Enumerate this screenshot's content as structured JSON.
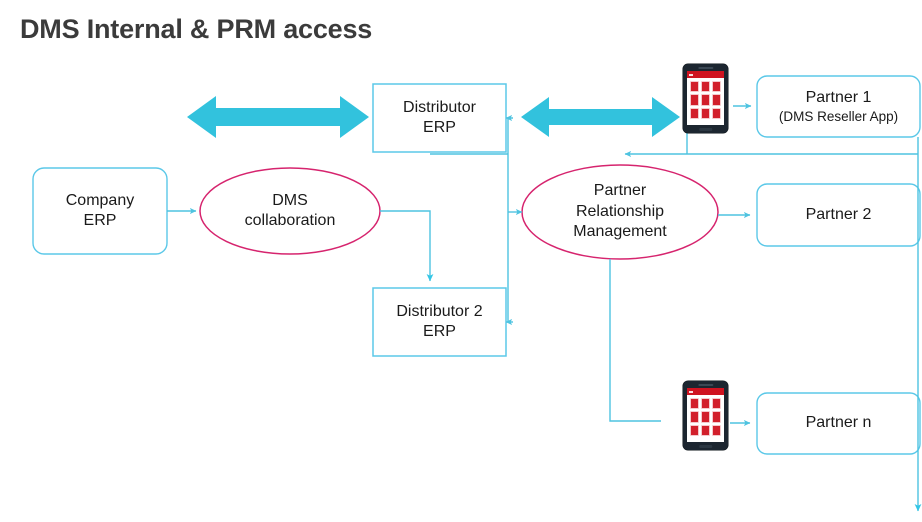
{
  "title": "DMS Internal & PRM access",
  "colors": {
    "connector": "#4ec3e0",
    "big_arrow": "#32c2dd",
    "box_border": "#5bc8e8",
    "ellipse_border": "#d6246e",
    "text": "#1a1a1a",
    "title": "#3b3b3b",
    "phone_body": "#1c2630",
    "phone_accent": "#cf1320",
    "background": "#ffffff"
  },
  "nodes": {
    "company_erp": {
      "line1": "Company",
      "line2": "ERP"
    },
    "dms_collaboration": {
      "line1": "DMS",
      "line2": "collaboration"
    },
    "distributor_erp": {
      "line1": "Distributor",
      "line2": "ERP"
    },
    "distributor2_erp": {
      "line1": "Distributor 2",
      "line2": "ERP"
    },
    "prm": {
      "line1": "Partner",
      "line2": "Relationship",
      "line3": "Management"
    },
    "partner1": {
      "line1": "Partner 1",
      "line2": "(DMS Reseller App)"
    },
    "partner2": {
      "line1": "Partner 2"
    },
    "partner_n": {
      "line1": "Partner n"
    }
  },
  "icons": {
    "phone_top": "smartphone-reseller-app-icon",
    "phone_bottom": "smartphone-reseller-app-icon"
  },
  "connectors": {
    "company_to_dms": "arrow-right",
    "dms_to_distributor2": "arrow-down",
    "bus_to_distributor_erp": "arrow-left",
    "bus_to_prm": "arrow-right",
    "bus_to_distributor2_erp": "arrow-left",
    "partner_return_to_prm": "arrow-left",
    "prm_to_partner2": "arrow-right",
    "phone_to_partner1": "arrow-right",
    "phone_to_partner_n": "arrow-right",
    "partner_bus_down": "arrow-down",
    "distributor_erp_bidirectional": "double-arrow",
    "distributor_erp_to_phone_bidirectional": "double-arrow"
  }
}
